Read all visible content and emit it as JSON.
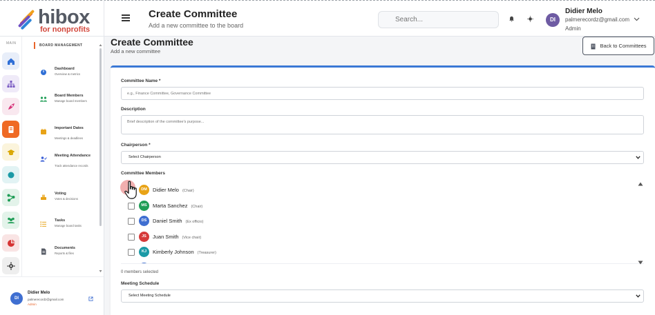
{
  "brand": {
    "name": "hibox",
    "tagline": "for nonprofits"
  },
  "header": {
    "title": "Create Committee",
    "subtitle": "Add a new committee to the board",
    "search_placeholder": "Search...",
    "user": {
      "initials": "DI",
      "name": "Didier Melo",
      "email": "palmerecordz@gmail.com",
      "role": "Admin"
    }
  },
  "rail": {
    "label": "MAIN",
    "items": [
      {
        "icon": "home-icon",
        "color": "#2f6fd6",
        "bg": "#e8eef9"
      },
      {
        "icon": "org-chart-icon",
        "color": "#7a5bc2",
        "bg": "#efeaf8"
      },
      {
        "icon": "rocket-icon",
        "color": "#d6357a",
        "bg": "#f9e8ef"
      },
      {
        "icon": "board-icon",
        "color": "#ffffff",
        "bg": "#ef6a24"
      },
      {
        "icon": "graduation-icon",
        "color": "#d9a600",
        "bg": "#fbf4dc"
      },
      {
        "icon": "circle-icon",
        "color": "#1b9aa6",
        "bg": "#e2f3f4"
      },
      {
        "icon": "network-icon",
        "color": "#1f9d56",
        "bg": "#e3f3ea"
      },
      {
        "icon": "team-icon",
        "color": "#1f9d56",
        "bg": "#e3f3ea"
      },
      {
        "icon": "pie-chart-icon",
        "color": "#d63535",
        "bg": "#f9e4e4"
      },
      {
        "icon": "settings-icon",
        "color": "#444444",
        "bg": "#eeeeee"
      }
    ]
  },
  "sidebar": {
    "section": "BOARD MANAGEMENT",
    "items": [
      {
        "title": "Dashboard",
        "desc": "Overview & metrics",
        "icon": "dashboard-icon",
        "color": "#2f6fd6"
      },
      {
        "title": "Board Members",
        "desc": "Manage board members",
        "icon": "members-icon",
        "color": "#1f9d56"
      },
      {
        "title": "Important Dates",
        "desc": "Meetings & deadlines",
        "icon": "calendar-icon",
        "color": "#e8a317"
      },
      {
        "title": "Meeting Attendance",
        "desc": "Track attendance records",
        "icon": "attendance-icon",
        "color": "#3a5fd6"
      },
      {
        "title": "Voting",
        "desc": "Votes & decisions",
        "icon": "vote-icon",
        "color": "#e8a317"
      },
      {
        "title": "Tasks",
        "desc": "Manage board tasks",
        "icon": "tasks-icon",
        "color": "#e8a317"
      },
      {
        "title": "Documents",
        "desc": "Reports & files",
        "icon": "document-icon",
        "color": "#555a64"
      }
    ],
    "footer": {
      "initials": "DI",
      "name": "Didier Melo",
      "email": "palmerecordz@gmail.com",
      "role": "Admin"
    }
  },
  "page": {
    "title": "Create Committee",
    "subtitle": "Add a new committee",
    "back_label": "Back to Committees"
  },
  "form": {
    "name_label": "Committee Name *",
    "name_placeholder": "e.g., Finance Committee, Governance Committee",
    "desc_label": "Description",
    "desc_placeholder": "Brief description of the committee's purpose...",
    "chair_label": "Chairperson *",
    "chair_value": "Select Chairperson",
    "members_label": "Committee Members",
    "members": [
      {
        "initials": "DM",
        "name": "Didier Melo",
        "role": "(Chair)",
        "color": "#e8a317",
        "checked": false
      },
      {
        "initials": "MS",
        "name": "Marta Sanchez",
        "role": "(Chair)",
        "color": "#1f9d56",
        "checked": false
      },
      {
        "initials": "DS",
        "name": "Daniel Smith",
        "role": "(Ex officio)",
        "color": "#3f6fd1",
        "checked": false
      },
      {
        "initials": "JS",
        "name": "Juan Smith",
        "role": "(Vice chair)",
        "color": "#d63a3a",
        "checked": false
      },
      {
        "initials": "KJ",
        "name": "Kimberly Johnson",
        "role": "(Treasurer)",
        "color": "#1b9aa6",
        "checked": false
      }
    ],
    "selected_count": "0 members selected",
    "schedule_label": "Meeting Schedule",
    "schedule_value": "Select Meeting Schedule"
  }
}
